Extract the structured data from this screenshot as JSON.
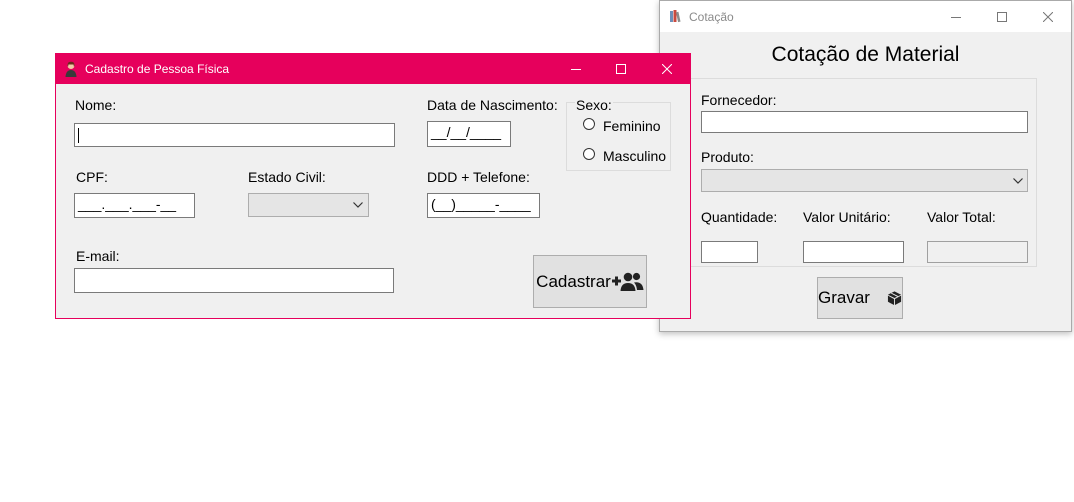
{
  "cadastro": {
    "title": "Cadastro de Pessoa Física",
    "nome_label": "Nome:",
    "nome_value": "",
    "data_nasc_label": "Data de Nascimento:",
    "data_nasc_mask": "__/__/____",
    "sexo_label": "Sexo:",
    "feminino_label": "Feminino",
    "masculino_label": "Masculino",
    "cpf_label": "CPF:",
    "cpf_mask": "___.___.___-__",
    "estado_civil_label": "Estado Civil:",
    "estado_civil_value": "",
    "telefone_label": "DDD + Telefone:",
    "telefone_mask": "(__)_____-____",
    "email_label": "E-mail:",
    "email_value": "",
    "cadastrar_label": "Cadastrar",
    "title_color": "#e6005c"
  },
  "cotacao": {
    "title": "Cotação",
    "heading": "Cotação de Material",
    "fornecedor_label": "Fornecedor:",
    "fornecedor_value": "",
    "produto_label": "Produto:",
    "produto_value": "",
    "quantidade_label": "Quantidade:",
    "quantidade_value": "",
    "valor_unitario_label": "Valor Unitário:",
    "valor_unitario_value": "",
    "valor_total_label": "Valor Total:",
    "valor_total_value": "",
    "gravar_label": "Gravar"
  },
  "icons": {
    "cadastro_window": "person-app-icon",
    "cotacao_window": "books-app-icon",
    "cadastrar": "add-users-icon",
    "gravar": "box-icon"
  }
}
